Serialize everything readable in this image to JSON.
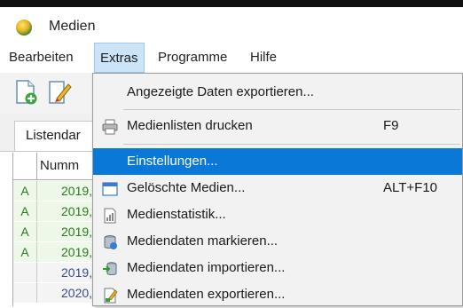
{
  "window": {
    "title": "Medien",
    "app_icon": "medien-app-icon"
  },
  "menubar": {
    "items": [
      {
        "label": "Bearbeiten",
        "active": false
      },
      {
        "label": "Extras",
        "active": true
      },
      {
        "label": "Programme",
        "active": false
      },
      {
        "label": "Hilfe",
        "active": false
      }
    ]
  },
  "toolbar": {
    "buttons": [
      {
        "icon": "new-document-icon"
      },
      {
        "icon": "edit-pencil-icon"
      }
    ]
  },
  "tabs": [
    {
      "label": "Listendar"
    }
  ],
  "grid": {
    "header": {
      "number_col": "Numm"
    },
    "rows": [
      {
        "status": "A",
        "number": "2019,"
      },
      {
        "status": "A",
        "number": "2019,"
      },
      {
        "status": "A",
        "number": "2019,"
      },
      {
        "status": "A",
        "number": "2019,"
      },
      {
        "status": "",
        "number": "2019,"
      },
      {
        "status": "",
        "number": "2020,"
      }
    ]
  },
  "extras_menu": {
    "items": [
      {
        "label": "Angezeigte Daten exportieren...",
        "shortcut": "",
        "icon": ""
      },
      {
        "label": "Medienlisten drucken",
        "shortcut": "F9",
        "icon": "printer-icon"
      },
      {
        "label": "Einstellungen...",
        "shortcut": "",
        "icon": "",
        "selected": true
      },
      {
        "label": "Gelöschte Medien...",
        "shortcut": "ALT+F10",
        "icon": "window-icon"
      },
      {
        "label": "Medienstatistik...",
        "shortcut": "",
        "icon": "statistics-icon"
      },
      {
        "label": "Mediendaten markieren...",
        "shortcut": "",
        "icon": "mark-data-icon"
      },
      {
        "label": "Mediendaten importieren...",
        "shortcut": "",
        "icon": "import-data-icon"
      },
      {
        "label": "Mediendaten exportieren...",
        "shortcut": "",
        "icon": "export-data-icon"
      }
    ]
  },
  "colors": {
    "selection": "#0a78d7",
    "menu_active": "#cce4f7",
    "status_green": "#2a7a1f"
  }
}
